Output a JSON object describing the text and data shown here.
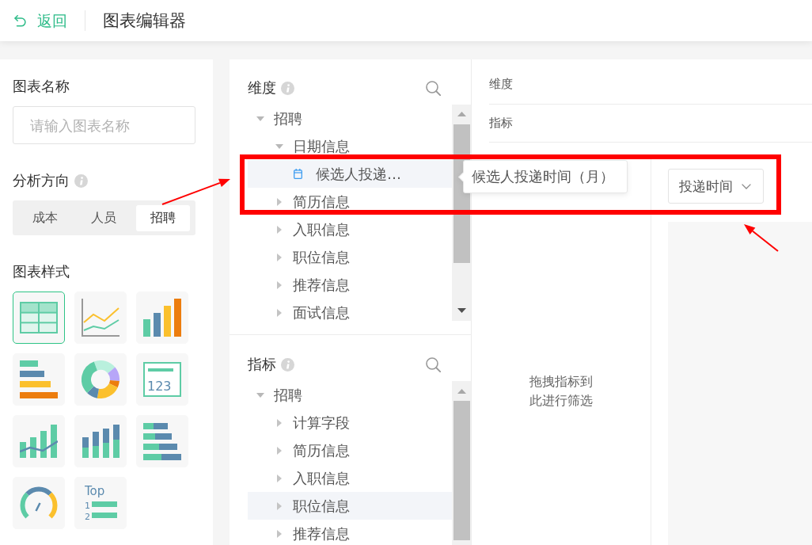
{
  "top_bar": {
    "back": "返回",
    "title": "图表编辑器"
  },
  "settings_panel": {
    "chart_name": {
      "label": "图表名称",
      "placeholder": "请输入图表名称"
    },
    "analysis_direction": {
      "label": "分析方向",
      "options": [
        {
          "label": "成本",
          "selected": false
        },
        {
          "label": "人员",
          "selected": false
        },
        {
          "label": "招聘",
          "selected": true
        }
      ]
    },
    "chart_style": {
      "label": "图表样式",
      "styles": [
        {
          "kind": "table",
          "selected": true
        },
        {
          "kind": "line",
          "selected": false
        },
        {
          "kind": "column",
          "selected": false
        },
        {
          "kind": "bar",
          "selected": false
        },
        {
          "kind": "donut",
          "selected": false
        },
        {
          "kind": "number",
          "text": "123",
          "selected": false
        },
        {
          "kind": "column-line",
          "selected": false
        },
        {
          "kind": "stacked-column",
          "selected": false
        },
        {
          "kind": "stacked-bar",
          "selected": false
        },
        {
          "kind": "gauge",
          "selected": false
        },
        {
          "kind": "ranking",
          "title": "Top",
          "ranks": [
            "1",
            "2"
          ],
          "selected": false
        }
      ]
    }
  },
  "dimension_panel": {
    "title": "维度",
    "tree": [
      {
        "kind": "folder",
        "label": "招聘",
        "expanded": true,
        "selected": false,
        "children": [
          {
            "kind": "folder",
            "label": "日期信息",
            "expanded": true,
            "selected": false,
            "children": [
              {
                "kind": "date-field",
                "label": "候选人投递…",
                "selected": true
              }
            ]
          },
          {
            "kind": "folder",
            "label": "简历信息",
            "expanded": false,
            "selected": false
          },
          {
            "kind": "folder",
            "label": "入职信息",
            "expanded": false,
            "selected": false
          },
          {
            "kind": "folder",
            "label": "职位信息",
            "expanded": false,
            "selected": false
          },
          {
            "kind": "folder",
            "label": "推荐信息",
            "expanded": false,
            "selected": false
          },
          {
            "kind": "folder",
            "label": "面试信息",
            "expanded": false,
            "selected": false
          }
        ]
      }
    ]
  },
  "measure_panel": {
    "title": "指标",
    "tree": [
      {
        "kind": "folder",
        "label": "招聘",
        "expanded": true,
        "selected": false,
        "children": [
          {
            "kind": "folder",
            "label": "计算字段",
            "expanded": false,
            "selected": false
          },
          {
            "kind": "folder",
            "label": "简历信息",
            "expanded": false,
            "selected": false
          },
          {
            "kind": "folder",
            "label": "入职信息",
            "expanded": false,
            "selected": false
          },
          {
            "kind": "folder",
            "label": "职位信息",
            "expanded": false,
            "selected": true
          },
          {
            "kind": "folder",
            "label": "推荐信息",
            "expanded": false,
            "selected": false
          }
        ]
      }
    ]
  },
  "tooltip": {
    "text": "候选人投递时间（月）"
  },
  "editor": {
    "drop_rows": [
      {
        "label": "维度"
      },
      {
        "label": "指标"
      }
    ],
    "filter_hint": "拖拽指标到此进行筛选",
    "time_dropdown": {
      "value": "投递时间"
    }
  },
  "annotations": [
    {
      "kind": "frame"
    },
    {
      "kind": "arrow"
    },
    {
      "kind": "arrow"
    }
  ]
}
